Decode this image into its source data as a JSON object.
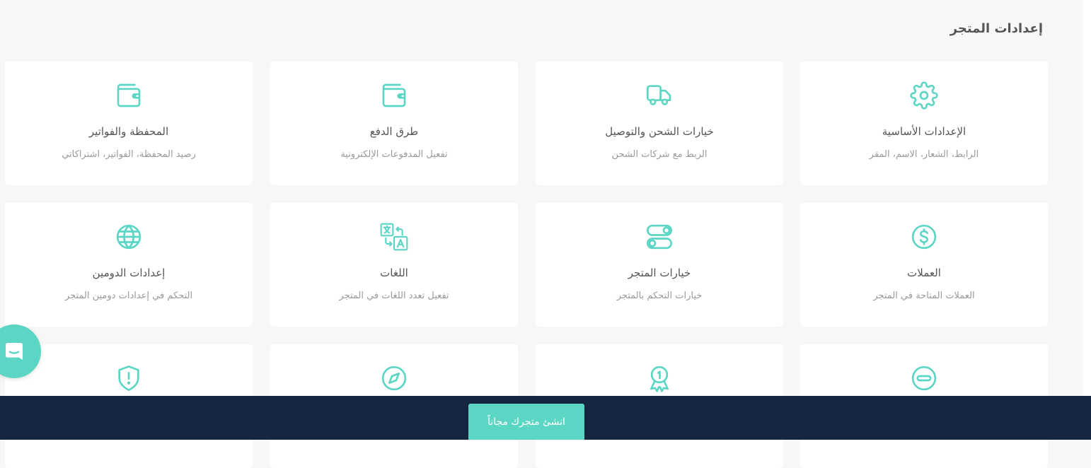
{
  "page": {
    "title": "إعدادات المتجر"
  },
  "colors": {
    "accent": "#5cd6c4",
    "footer": "#172640",
    "background": "#f7f7f7"
  },
  "cards": [
    {
      "title": "الإعدادات الأساسية",
      "subtitle": "الرابط، الشعار، الاسم، المقر",
      "icon": "gear-icon"
    },
    {
      "title": "خيارات الشحن والتوصيل",
      "subtitle": "الربط مع شركات الشحن",
      "icon": "truck-icon"
    },
    {
      "title": "طرق الدفع",
      "subtitle": "تفعيل المدفوعات الإلكترونية",
      "icon": "wallet-icon"
    },
    {
      "title": "المحفظة والفواتير",
      "subtitle": "رصيد المحفظة، الفواتير، اشتراكاتي",
      "icon": "wallet-icon"
    },
    {
      "title": "العملات",
      "subtitle": "العملات المتاحة في المتجر",
      "icon": "dollar-icon"
    },
    {
      "title": "خيارات المتجر",
      "subtitle": "خيارات التحكم بالمتجر",
      "icon": "toggles-icon"
    },
    {
      "title": "اللغات",
      "subtitle": "تفعيل تعدد اللغات في المتجر",
      "icon": "translate-icon"
    },
    {
      "title": "إعدادات الدومين",
      "subtitle": "التحكم في إعدادات دومين المتجر",
      "icon": "globe-icon"
    },
    {
      "icon": "minus-circle-icon"
    },
    {
      "icon": "award-icon"
    },
    {
      "icon": "compass-icon"
    },
    {
      "icon": "shield-alert-icon"
    }
  ],
  "footer": {
    "cta_label": "انشئ متجرك مجاناً"
  },
  "chat": {
    "icon": "chat-icon"
  }
}
